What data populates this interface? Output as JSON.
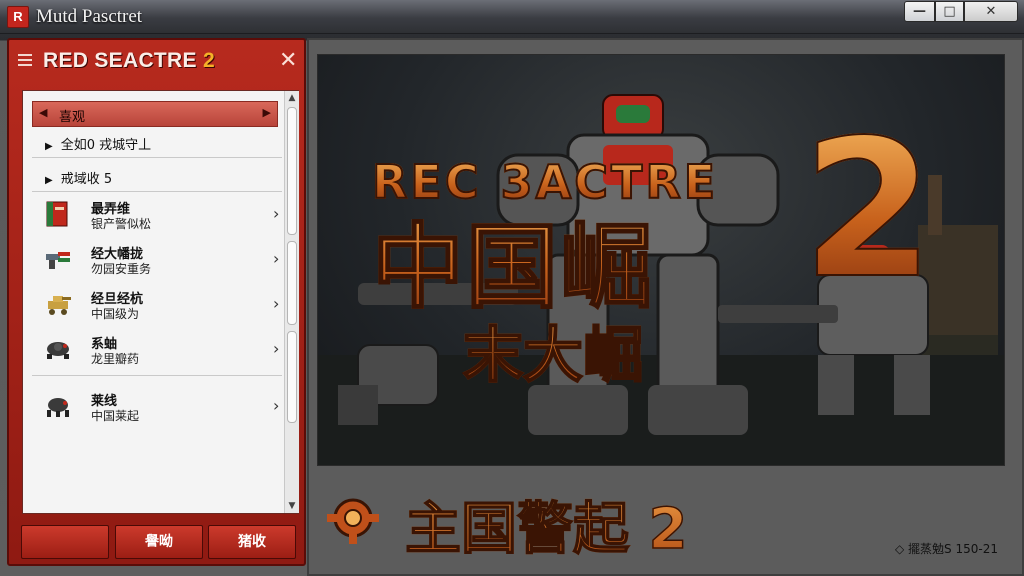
{
  "window": {
    "title": "Mutd Pasctret",
    "icon_glyph": "R",
    "controls": {
      "minimize": "—",
      "maximize": "□",
      "close": "✕"
    }
  },
  "panel": {
    "title_main": "RED SEACTRE",
    "title_num": "2",
    "close_glyph": "✕",
    "selected": {
      "label": "喜观",
      "left_glyph": "◀",
      "right_glyph": "▶"
    },
    "sub_items": [
      {
        "label": "全如0  戎城守丄",
        "glyph": "▶"
      },
      {
        "label": "戒域收 5",
        "glyph": "▶"
      }
    ],
    "units": [
      {
        "line1": "最弄维",
        "line2": "银产警似松",
        "icon": "book-icon",
        "chevron": "›"
      },
      {
        "line1": "经大幡拢",
        "line2": "勿园安重务",
        "icon": "rocket-turret-icon",
        "chevron": "›"
      },
      {
        "line1": "经旦经杭",
        "line2": "中国级为",
        "icon": "tank-icon",
        "chevron": "›"
      },
      {
        "line1": "系蚰",
        "line2": "龙里瓣药",
        "icon": "drone-icon",
        "chevron": "›"
      },
      {
        "line1": "莱线",
        "line2": "中国莱起",
        "icon": "spider-bot-icon",
        "chevron": "›"
      }
    ],
    "scroll": {
      "up": "▲",
      "down": "▼"
    },
    "buttons": [
      "",
      "譽呦",
      "猪收"
    ]
  },
  "banner": {
    "art_title_en": "REC 3ACTRE",
    "art_title_cn": "中国崛",
    "art_subtitle_cn": "末大崛",
    "art_numeral": "2",
    "logo_text": "主国警起 2",
    "version": "◇ 擺蒸勉S 150-21"
  },
  "colors": {
    "accent_red": "#b72a1e",
    "title_orange": "#d2702a"
  }
}
